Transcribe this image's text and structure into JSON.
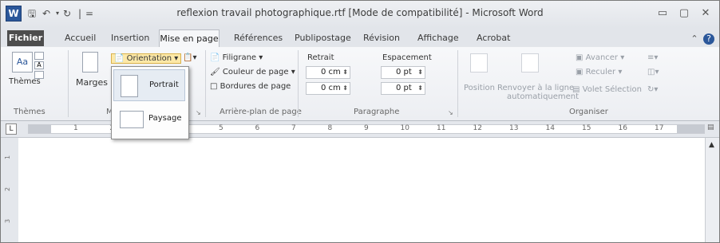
{
  "titlebar": {
    "app_icon_letter": "W",
    "title": "reflexion travail photographique.rtf [Mode de compatibilité] - Microsoft Word",
    "qat_separator": "|",
    "qat_customize": "=",
    "minimize": "▭",
    "maximize": "▢",
    "close": "✕"
  },
  "tabs": [
    "Fichier",
    "Accueil",
    "Insertion",
    "Mise en page",
    "Références",
    "Publipostage",
    "Révision",
    "Affichage",
    "Acrobat"
  ],
  "ribbon": {
    "themes": {
      "label": "Thèmes",
      "group": "Thèmes"
    },
    "page_setup": {
      "marges": "Marges",
      "orientation": "Orientation",
      "group_initial": "M"
    },
    "arriere_plan": {
      "filigrane": "Filigrane",
      "couleur": "Couleur de page",
      "bordures": "Bordures de page",
      "group": "Arrière-plan de page"
    },
    "paragraphe": {
      "retrait": "Retrait",
      "espacement": "Espacement",
      "retrait_left": "0 cm",
      "retrait_right": "0 cm",
      "esp_before": "0 pt",
      "esp_after": "0 pt",
      "group": "Paragraphe"
    },
    "organiser": {
      "position": "Position",
      "renvoyer_1": "Renvoyer à la ligne",
      "renvoyer_2": "automatiquement",
      "avancer": "Avancer",
      "reculer": "Reculer",
      "volet": "Volet Sélection",
      "group": "Organiser"
    }
  },
  "dropdown": {
    "portrait": "Portrait",
    "paysage": "Paysage"
  },
  "ruler": {
    "tab_selector": "L",
    "ticks": [
      "1",
      "2",
      "3",
      "4",
      "5",
      "6",
      "7",
      "8",
      "9",
      "10",
      "11",
      "12",
      "13",
      "14",
      "15",
      "16",
      "17"
    ]
  },
  "vruler": [
    "1",
    "2",
    "3"
  ],
  "colors": {
    "accent": "#2b579a",
    "fichier_tab": "#4d4d4d"
  }
}
